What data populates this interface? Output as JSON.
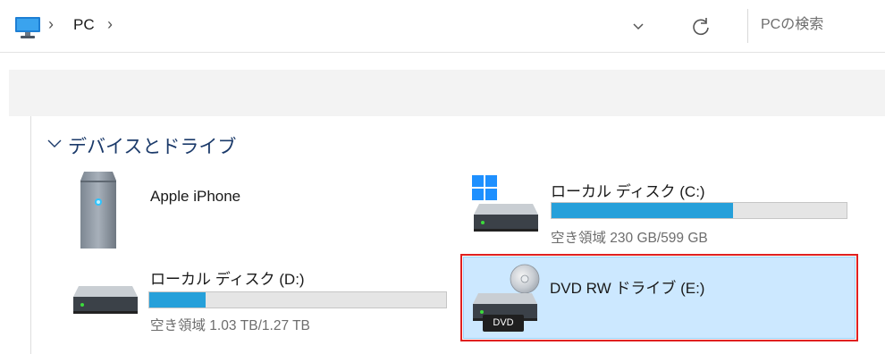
{
  "address_bar": {
    "breadcrumb_sep": "›",
    "location": "PC",
    "search_placeholder": "PCの検索",
    "icons": [
      "pc-icon",
      "chevron-down-icon",
      "refresh-icon"
    ]
  },
  "devices_section": {
    "title": "デバイスとドライブ",
    "items": [
      {
        "name": "Apple iPhone",
        "icon": "phone-device-icon"
      },
      {
        "name": "ローカル ディスク (C:)",
        "icon": "windows-drive-icon",
        "free_text": "空き領域 230 GB/599 GB",
        "used_fraction": 0.616
      },
      {
        "name": "ローカル ディスク (D:)",
        "icon": "hard-drive-icon",
        "free_text": "空き領域 1.03 TB/1.27 TB",
        "used_fraction": 0.19
      },
      {
        "name": "DVD RW ドライブ (E:)",
        "icon": "dvd-drive-icon",
        "badge": "DVD",
        "selected": true
      }
    ]
  },
  "colors": {
    "accent": "#26a0da",
    "selection_bg": "#cce8ff",
    "highlight_frame": "#e02020",
    "section_title": "#1b3a6a"
  }
}
